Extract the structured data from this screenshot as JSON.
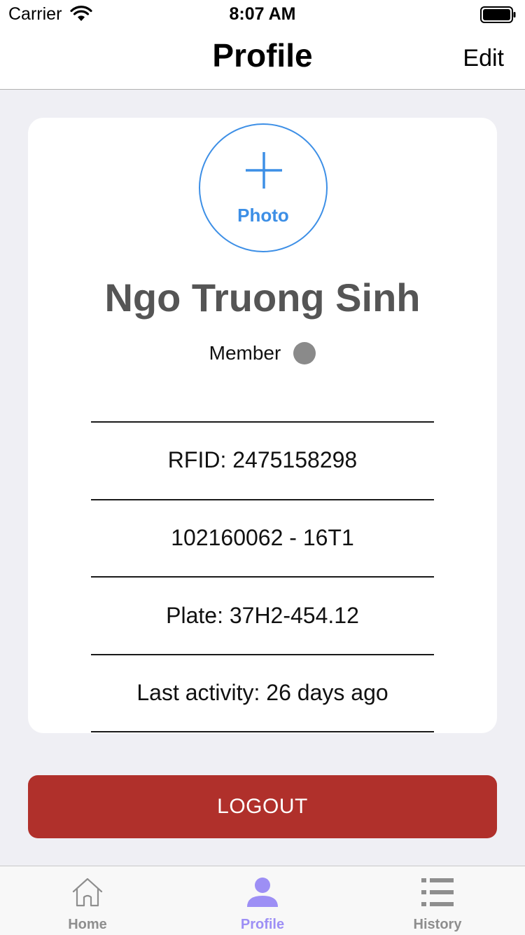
{
  "status_bar": {
    "carrier": "Carrier",
    "time": "8:07 AM",
    "wifi_icon": "wifi-icon",
    "battery_icon": "battery-icon"
  },
  "nav": {
    "title": "Profile",
    "edit_label": "Edit"
  },
  "profile": {
    "photo_label": "Photo",
    "photo_icon": "plus-icon",
    "name": "Ngo Truong Sinh",
    "role": "Member",
    "info": [
      "RFID: 2475158298",
      "102160062 - 16T1",
      "Plate: 37H2-454.12",
      "Last activity: 26 days ago"
    ]
  },
  "logout": {
    "label": "LOGOUT"
  },
  "tabs": [
    {
      "label": "Home",
      "icon": "home-icon",
      "active": false
    },
    {
      "label": "Profile",
      "icon": "person-icon",
      "active": true
    },
    {
      "label": "History",
      "icon": "list-icon",
      "active": false
    }
  ],
  "colors": {
    "accent_blue": "#3d8fe6",
    "logout_red": "#b0302b",
    "tab_active": "#9d8ff5",
    "tab_inactive": "#8e8e8e",
    "background": "#efeff4"
  }
}
